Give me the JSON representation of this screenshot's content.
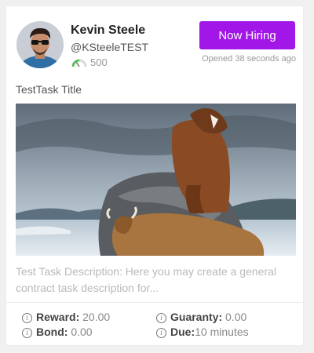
{
  "user": {
    "name": "Kevin Steele",
    "handle": "@KSteeleTEST",
    "score": "500"
  },
  "actions": {
    "hire_label": "Now Hiring",
    "opened_text": "Opened 38 seconds ago"
  },
  "task": {
    "title": "TestTask Title",
    "description": "Test Task Description: Here you may create a general contract task description for..."
  },
  "details": {
    "reward_label": "Reward:",
    "reward_value": "20.00",
    "guaranty_label": "Guaranty:",
    "guaranty_value": "0.00",
    "bond_label": "Bond:",
    "bond_value": "0.00",
    "due_label": "Due:",
    "due_value": "10 minutes"
  },
  "colors": {
    "accent": "#a217e8",
    "score_gauge": "#5cc25a"
  },
  "icons": [
    "speedometer-icon",
    "info-icon"
  ]
}
